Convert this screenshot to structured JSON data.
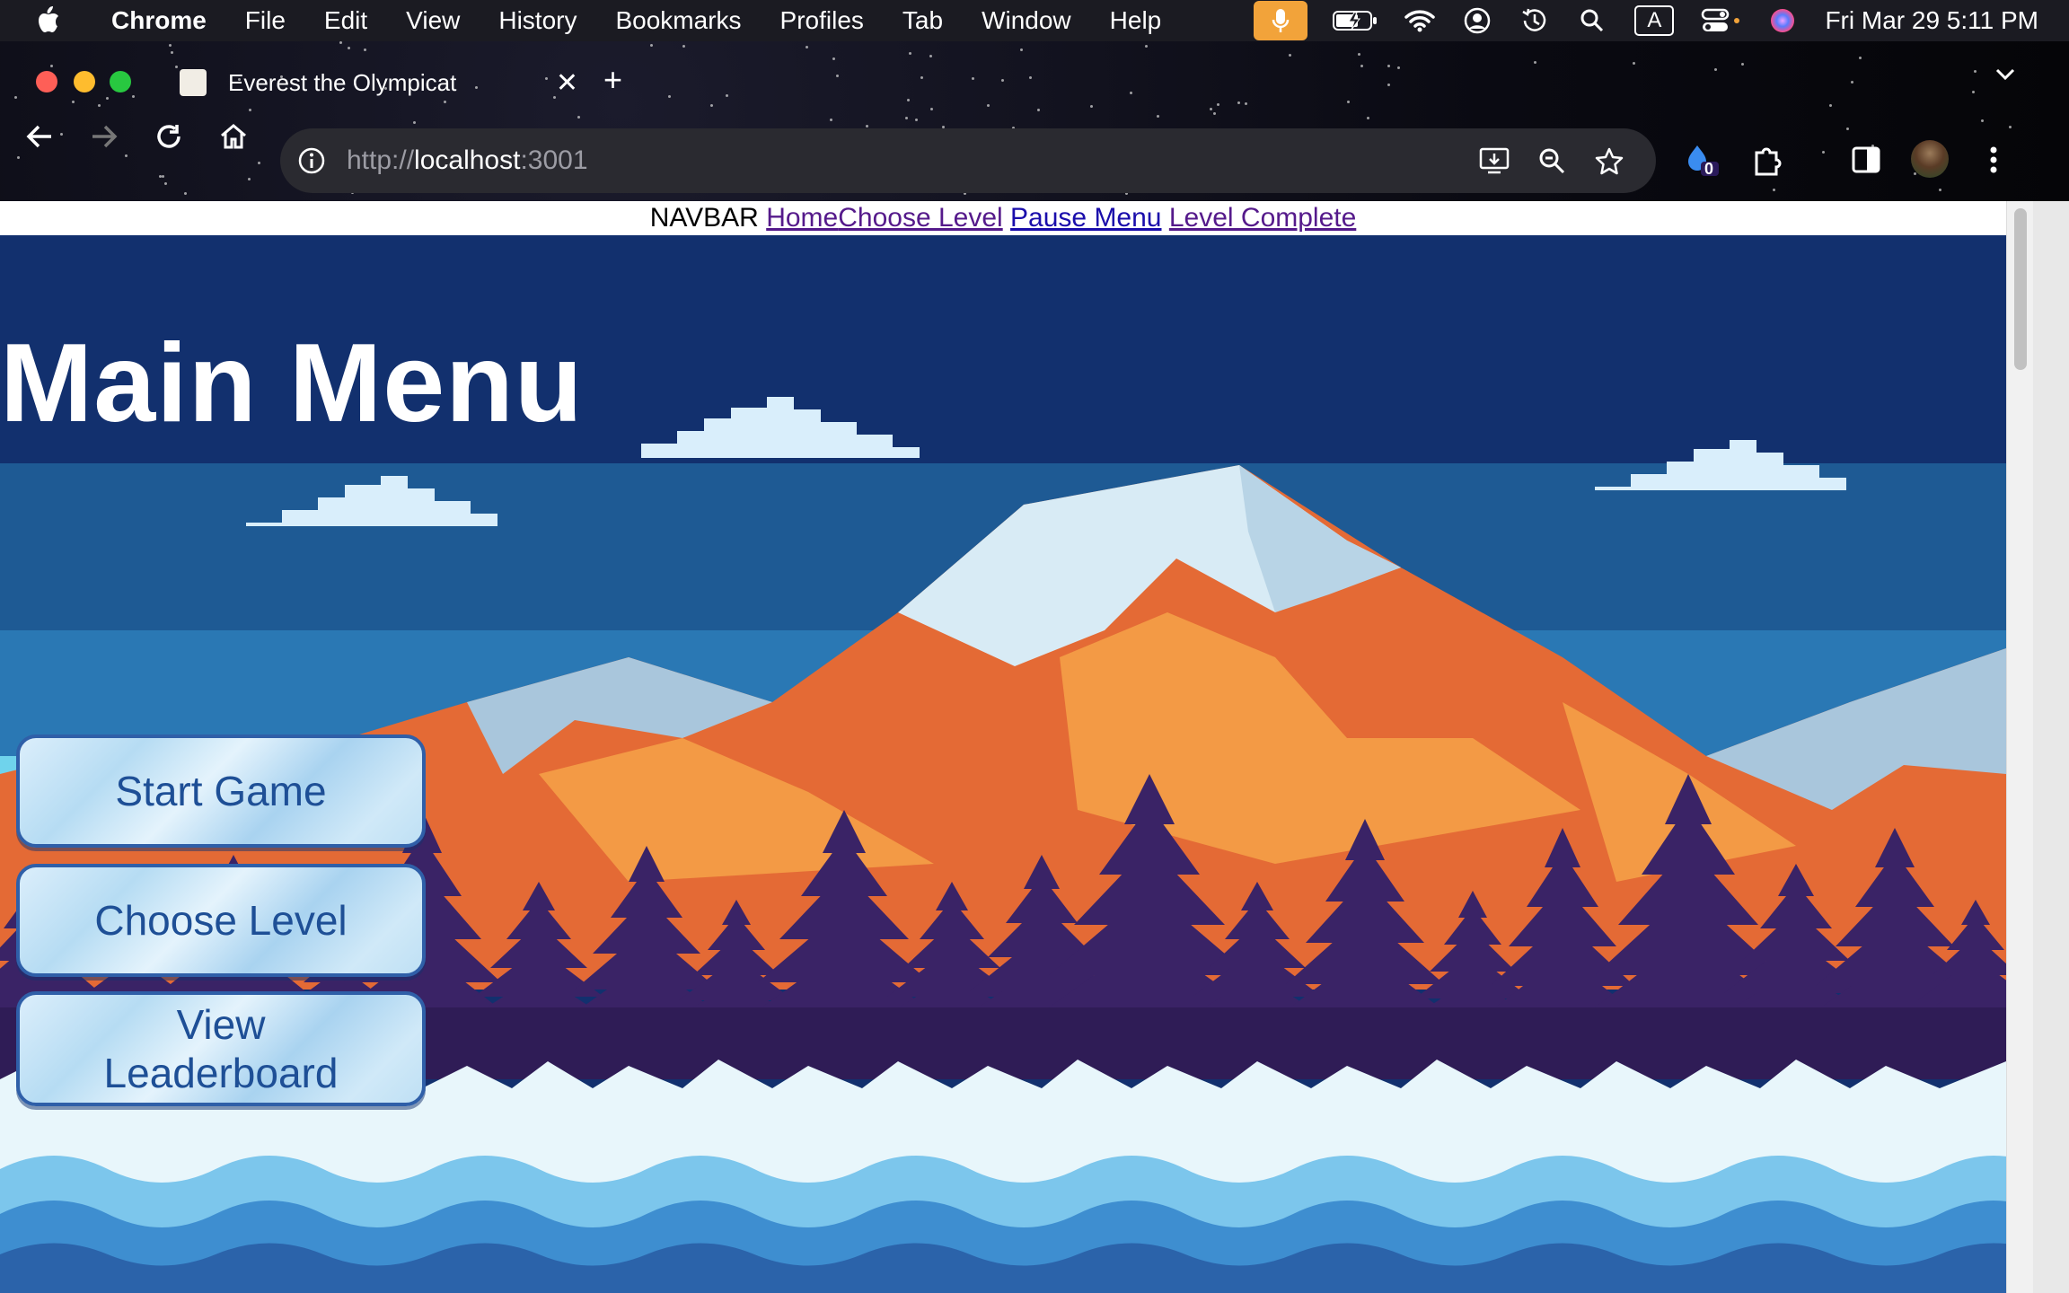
{
  "menubar": {
    "app": "Chrome",
    "items": [
      "File",
      "Edit",
      "View",
      "History",
      "Bookmarks",
      "Profiles",
      "Tab",
      "Window",
      "Help"
    ],
    "clock": "Fri Mar 29  5:11 PM",
    "status_icons": [
      "microphone-icon",
      "battery-icon",
      "wifi-icon",
      "user-icon",
      "time-machine-icon",
      "spotlight-icon",
      "input-source-icon",
      "control-center-icon",
      "siri-icon"
    ],
    "input_source": "A"
  },
  "browser": {
    "tab_title": "Everest the Olympicat",
    "url_scheme": "http://",
    "url_host": "localhost",
    "url_port": ":3001",
    "extension_badge": "0"
  },
  "page": {
    "navbar": {
      "label": "NAVBAR",
      "links": [
        "Home",
        "Choose Level",
        "Pause Menu",
        "Level Complete"
      ]
    },
    "title": "Main Menu",
    "buttons": {
      "start": "Start Game",
      "choose_level": "Choose Level",
      "leaderboard": "View Leaderboard"
    }
  },
  "colors": {
    "sky_dark": "#12306e",
    "sky_mid": "#2a6fa6",
    "mountain_orange": "#e46a35",
    "tree_purple": "#3a2366",
    "snow": "#e8f6fb",
    "button_text": "#1e4f96"
  }
}
